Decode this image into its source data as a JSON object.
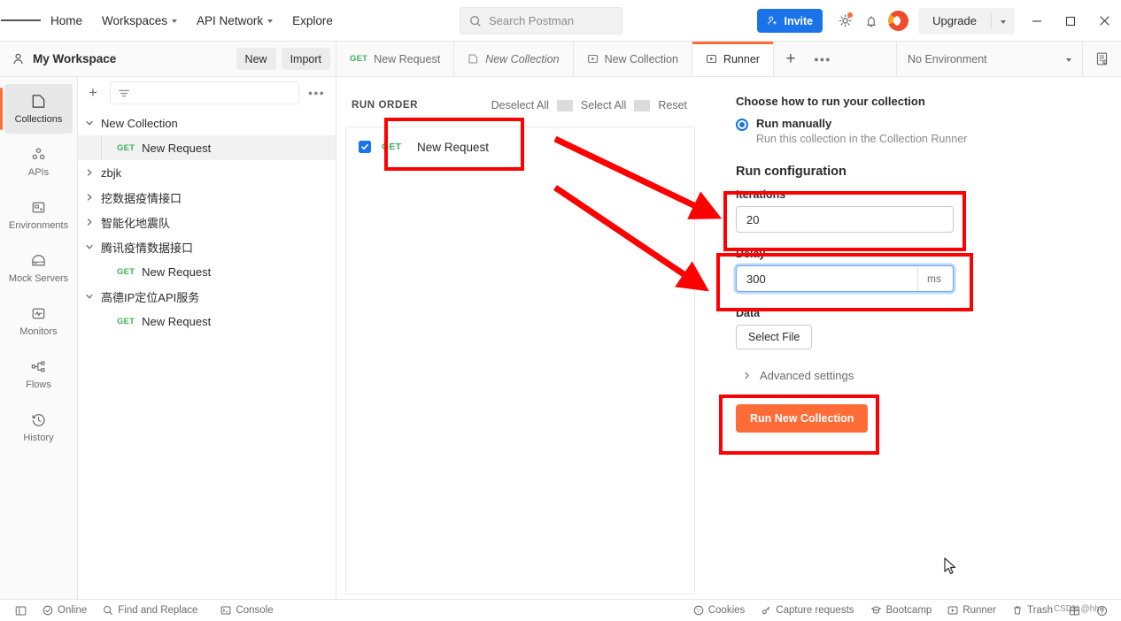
{
  "topbar": {
    "nav": [
      {
        "label": "Home",
        "caret": false,
        "name": "nav-home"
      },
      {
        "label": "Workspaces",
        "caret": true,
        "name": "nav-workspaces"
      },
      {
        "label": "API Network",
        "caret": true,
        "name": "nav-api-network"
      },
      {
        "label": "Explore",
        "caret": false,
        "name": "nav-explore"
      }
    ],
    "search_placeholder": "Search Postman",
    "invite_label": "Invite",
    "upgrade_label": "Upgrade"
  },
  "workspace": {
    "title": "My Workspace",
    "new_label": "New",
    "import_label": "Import"
  },
  "tabs": [
    {
      "label": "New Request",
      "method": "GET",
      "icon": "",
      "active": false,
      "italic": false
    },
    {
      "label": "New Collection",
      "method": "",
      "icon": "collection-icon",
      "active": false,
      "italic": true
    },
    {
      "label": "New Collection",
      "method": "",
      "icon": "runner-icon",
      "active": false,
      "italic": false
    },
    {
      "label": "Runner",
      "method": "",
      "icon": "runner-icon",
      "active": true,
      "italic": false
    }
  ],
  "environment": {
    "selected": "No Environment"
  },
  "rail": [
    {
      "label": "Collections",
      "icon": "collections-icon",
      "active": true
    },
    {
      "label": "APIs",
      "icon": "apis-icon",
      "active": false
    },
    {
      "label": "Environments",
      "icon": "environments-icon",
      "active": false
    },
    {
      "label": "Mock Servers",
      "icon": "mock-servers-icon",
      "active": false
    },
    {
      "label": "Monitors",
      "icon": "monitors-icon",
      "active": false
    },
    {
      "label": "Flows",
      "icon": "flows-icon",
      "active": false
    },
    {
      "label": "History",
      "icon": "history-icon",
      "active": false
    }
  ],
  "sidebar": {
    "filter_placeholder": "",
    "tree": [
      {
        "label": "New Collection",
        "type": "collection",
        "expanded": true,
        "selected": false
      },
      {
        "label": "New Request",
        "type": "request",
        "method": "GET",
        "selected": true
      },
      {
        "label": "zbjk",
        "type": "collection",
        "expanded": false,
        "selected": false
      },
      {
        "label": "挖数据疫情接口",
        "type": "collection",
        "expanded": false,
        "selected": false
      },
      {
        "label": "智能化地震队",
        "type": "collection",
        "expanded": false,
        "selected": false
      },
      {
        "label": "腾讯疫情数据接口",
        "type": "collection",
        "expanded": true,
        "selected": false
      },
      {
        "label": "New Request",
        "type": "request",
        "method": "GET",
        "selected": false
      },
      {
        "label": "高德IP定位API服务",
        "type": "collection",
        "expanded": true,
        "selected": false
      },
      {
        "label": "New Request",
        "type": "request",
        "method": "GET",
        "selected": false
      }
    ]
  },
  "run_order": {
    "title": "RUN ORDER",
    "deselect_all": "Deselect All",
    "select_all": "Select All",
    "reset": "Reset",
    "items": [
      {
        "method": "GET",
        "name": "New Request",
        "checked": true
      }
    ]
  },
  "config": {
    "choose_heading": "Choose how to run your collection",
    "run_manually_title": "Run manually",
    "run_manually_sub": "Run this collection in the Collection Runner",
    "run_config_heading": "Run configuration",
    "iterations_label": "Iterations",
    "iterations_value": "20",
    "delay_label": "Delay",
    "delay_value": "300",
    "delay_unit": "ms",
    "data_label": "Data",
    "select_file_label": "Select File",
    "advanced_settings_label": "Advanced settings",
    "run_button_label": "Run New Collection",
    "accent_color": "#ff6c37",
    "focus_color": "#6aa9f4"
  },
  "statusbar": {
    "left": [
      {
        "label": "",
        "icon": "sidebar-toggle-icon"
      },
      {
        "label": "Online",
        "icon": "online-icon"
      },
      {
        "label": "Find and Replace",
        "icon": "search-icon"
      },
      {
        "label": "Console",
        "icon": "console-icon"
      }
    ],
    "right": [
      {
        "label": "Cookies",
        "icon": "cookie-icon"
      },
      {
        "label": "Capture requests",
        "icon": "capture-icon"
      },
      {
        "label": "Bootcamp",
        "icon": "bootcamp-icon"
      },
      {
        "label": "Runner",
        "icon": "runner-icon"
      },
      {
        "label": "Trash",
        "icon": "trash-icon"
      },
      {
        "label": "",
        "icon": "layout-icon"
      },
      {
        "label": "",
        "icon": "help-icon"
      }
    ]
  },
  "watermark": {
    "text": "CSDN @hhu"
  },
  "annotations": {
    "color": "#fe0000"
  }
}
